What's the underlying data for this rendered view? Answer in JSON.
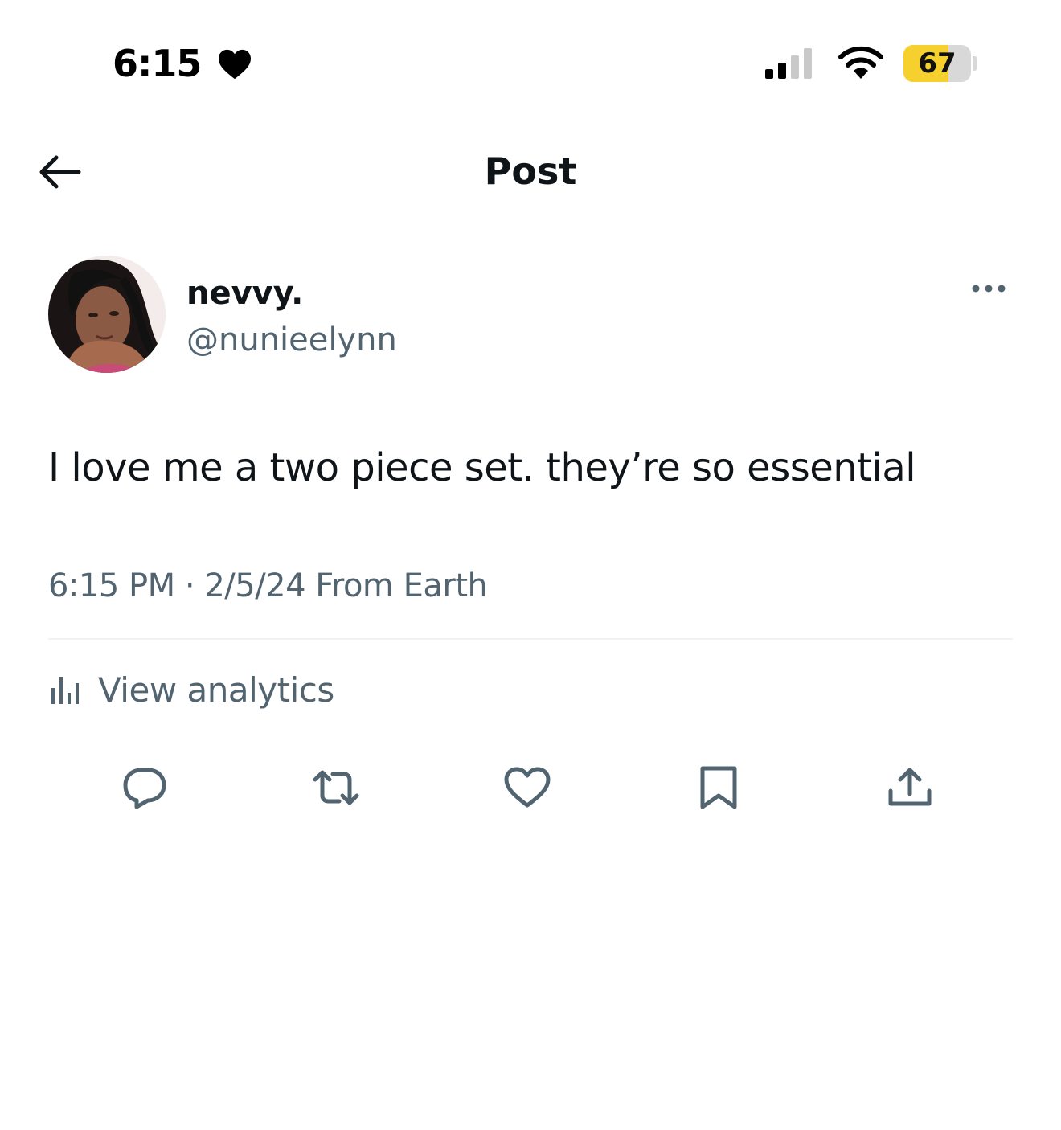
{
  "status_bar": {
    "time": "6:15",
    "battery_label": "67",
    "battery_level_percent": 67,
    "battery_color": "#f5d02f",
    "icons": [
      "heart-icon",
      "cellular-signal-icon",
      "wifi-icon",
      "battery-icon"
    ]
  },
  "header": {
    "title": "Post",
    "back_icon": "arrow-left-icon"
  },
  "post": {
    "author": {
      "display_name": "nevvy.",
      "handle": "@nunieelynn",
      "avatar": "profile-photo"
    },
    "more_icon": "ellipsis-icon",
    "text": "I love me a two piece set. they’re so essential",
    "timestamp": "6:15 PM · 2/5/24 From Earth",
    "analytics": {
      "label": "View analytics",
      "icon": "bar-chart-icon"
    },
    "actions": [
      "reply-icon",
      "repost-icon",
      "like-icon",
      "bookmark-icon",
      "share-icon"
    ]
  },
  "colors": {
    "primary_text": "#0f1419",
    "secondary_text": "#536471",
    "divider": "#eff3f4"
  }
}
